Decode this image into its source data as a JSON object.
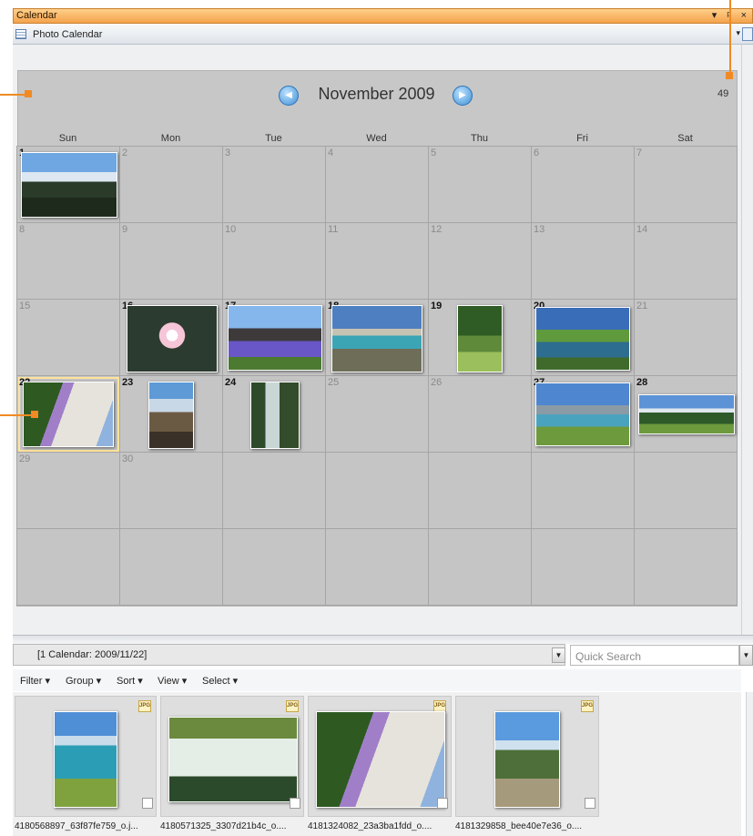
{
  "window": {
    "title": "Calendar",
    "tool_icons": "▾ ᵖ ×"
  },
  "panel": {
    "label": "Photo Calendar",
    "dropdown": "▾"
  },
  "calendar": {
    "month_title": "November 2009",
    "prev_arrow": "◀",
    "next_arrow": "▶",
    "count": "49",
    "weekdays": [
      "Sun",
      "Mon",
      "Tue",
      "Wed",
      "Thu",
      "Fri",
      "Sat"
    ],
    "days": [
      "1",
      "2",
      "3",
      "4",
      "5",
      "6",
      "7",
      "8",
      "9",
      "10",
      "11",
      "12",
      "13",
      "14",
      "15",
      "16",
      "17",
      "18",
      "19",
      "20",
      "21",
      "22",
      "23",
      "24",
      "25",
      "26",
      "27",
      "28",
      "29",
      "30"
    ]
  },
  "pathbar": {
    "text": "[1 Calendar: 2009/11/22]"
  },
  "search": {
    "placeholder": "Quick Search"
  },
  "filterbar": {
    "filter": "Filter ▾",
    "group": "Group ▾",
    "sort": "Sort ▾",
    "view": "View ▾",
    "select": "Select ▾"
  },
  "thumbnails": [
    {
      "label": "4180568897_63f87fe759_o.j...",
      "badge": "JPG"
    },
    {
      "label": "4180571325_3307d21b4c_o....",
      "badge": "JPG"
    },
    {
      "label": "4181324082_23a3ba1fdd_o....",
      "badge": "JPG"
    },
    {
      "label": "4181329858_bee40e7e36_o....",
      "badge": "JPG"
    }
  ]
}
